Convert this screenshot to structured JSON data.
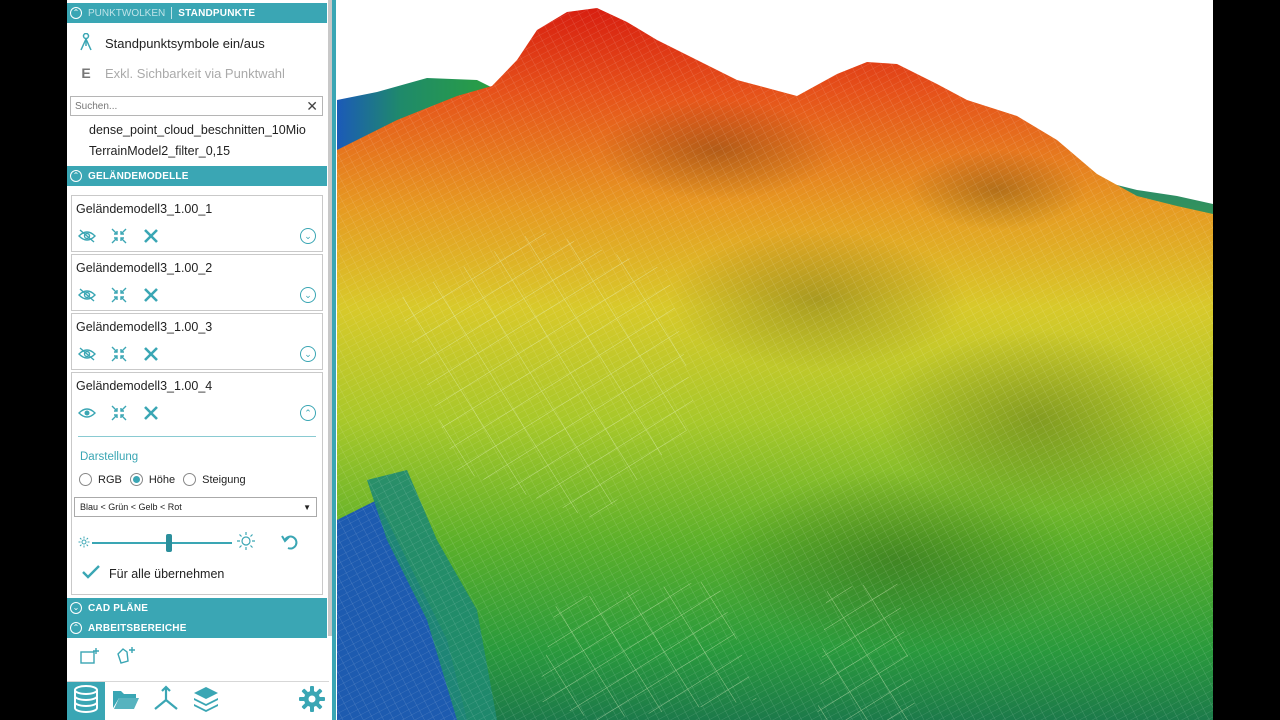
{
  "sections": {
    "point_clouds": {
      "label": "PUNKTWOLKEN",
      "active_tab": "STANDPUNKTE"
    },
    "terrain_models": {
      "label": "GELÄNDEMODELLE"
    },
    "cad": {
      "label": "CAD PLÄNE"
    },
    "workspaces": {
      "label": "ARBEITSBEREICHE"
    }
  },
  "standpoints": {
    "toggle_symbols": "Standpunktsymbole ein/aus",
    "exclusive_visibility": "Exkl. Sichbarkeit via Punktwahl",
    "exclusive_letter": "E"
  },
  "search": {
    "placeholder": "Suchen..."
  },
  "point_cloud_items": [
    "dense_point_cloud_beschnitten_10Mio",
    "TerrainModel2_filter_0,15"
  ],
  "models": [
    {
      "name": "Geländemodell3_1.00_1",
      "visible": false,
      "expanded": false
    },
    {
      "name": "Geländemodell3_1.00_2",
      "visible": false,
      "expanded": false
    },
    {
      "name": "Geländemodell3_1.00_3",
      "visible": false,
      "expanded": false
    },
    {
      "name": "Geländemodell3_1.00_4",
      "visible": true,
      "expanded": true
    }
  ],
  "display": {
    "label": "Darstellung",
    "options": [
      "RGB",
      "Höhe",
      "Steigung"
    ],
    "selected": "Höhe",
    "colormap": "Blau < Grün < Gelb < Rot",
    "brightness": 0.55,
    "apply_all": "Für alle übernehmen"
  },
  "colors": {
    "accent": "#3aa6b4"
  },
  "bottom_nav": [
    "database-icon",
    "folder-icon",
    "axes-icon",
    "layers-icon",
    "gear-icon"
  ]
}
